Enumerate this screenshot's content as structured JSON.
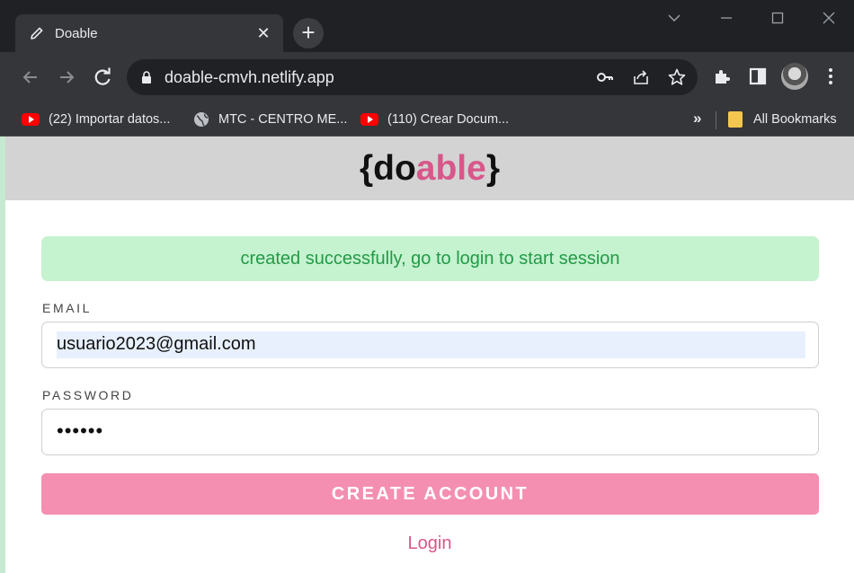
{
  "browser": {
    "tab_title": "Doable",
    "tab_close": "✕",
    "new_tab": "+",
    "url": "doable-cmvh.netlify.app",
    "bookmarks": [
      {
        "label": "(22) Importar datos...",
        "icon": "youtube-icon"
      },
      {
        "label": "MTC - CENTRO ME...",
        "icon": "globe-icon"
      },
      {
        "label": "(110) Crear Docum...",
        "icon": "youtube-icon"
      }
    ],
    "overflow": "»",
    "all_bookmarks": "All Bookmarks"
  },
  "app": {
    "logo": {
      "open": "{",
      "part1": "do",
      "part2": "able",
      "close": "}"
    },
    "accent_color": "#d8578a",
    "alert": "created successfully, go to login to start session",
    "email": {
      "label": "EMAIL",
      "value": "usuario2023@gmail.com"
    },
    "password": {
      "label": "PASSWORD",
      "value": "••••••"
    },
    "create_button": "CREATE ACCOUNT",
    "login_link": "Login"
  }
}
